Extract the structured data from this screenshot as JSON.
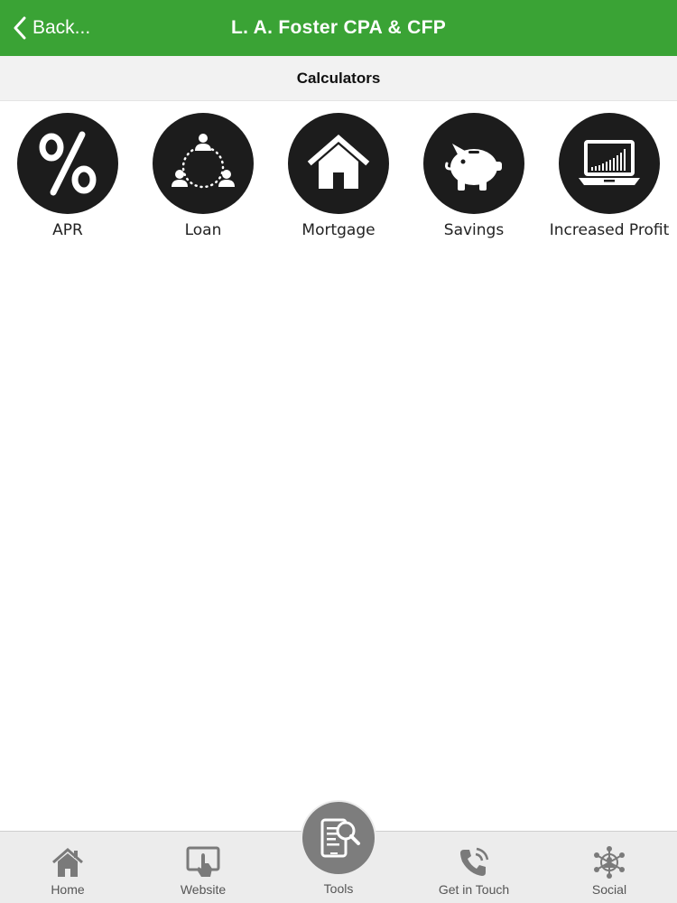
{
  "header": {
    "back_label": "Back...",
    "title": "L. A. Foster CPA & CFP",
    "background_color": "#3aa335"
  },
  "subheader": {
    "title": "Calculators"
  },
  "calculators": [
    {
      "label": "APR",
      "icon": "percent-icon"
    },
    {
      "label": "Loan",
      "icon": "people-network-icon"
    },
    {
      "label": "Mortgage",
      "icon": "house-icon"
    },
    {
      "label": "Savings",
      "icon": "piggy-bank-icon"
    },
    {
      "label": "Increased Profit",
      "icon": "laptop-chart-icon"
    }
  ],
  "tabbar": {
    "items": [
      {
        "label": "Home",
        "icon": "home-icon"
      },
      {
        "label": "Website",
        "icon": "website-touch-icon"
      },
      {
        "label": "Tools",
        "icon": "tools-search-icon",
        "active": true
      },
      {
        "label": "Get in Touch",
        "icon": "phone-icon"
      },
      {
        "label": "Social",
        "icon": "social-network-icon"
      }
    ]
  }
}
